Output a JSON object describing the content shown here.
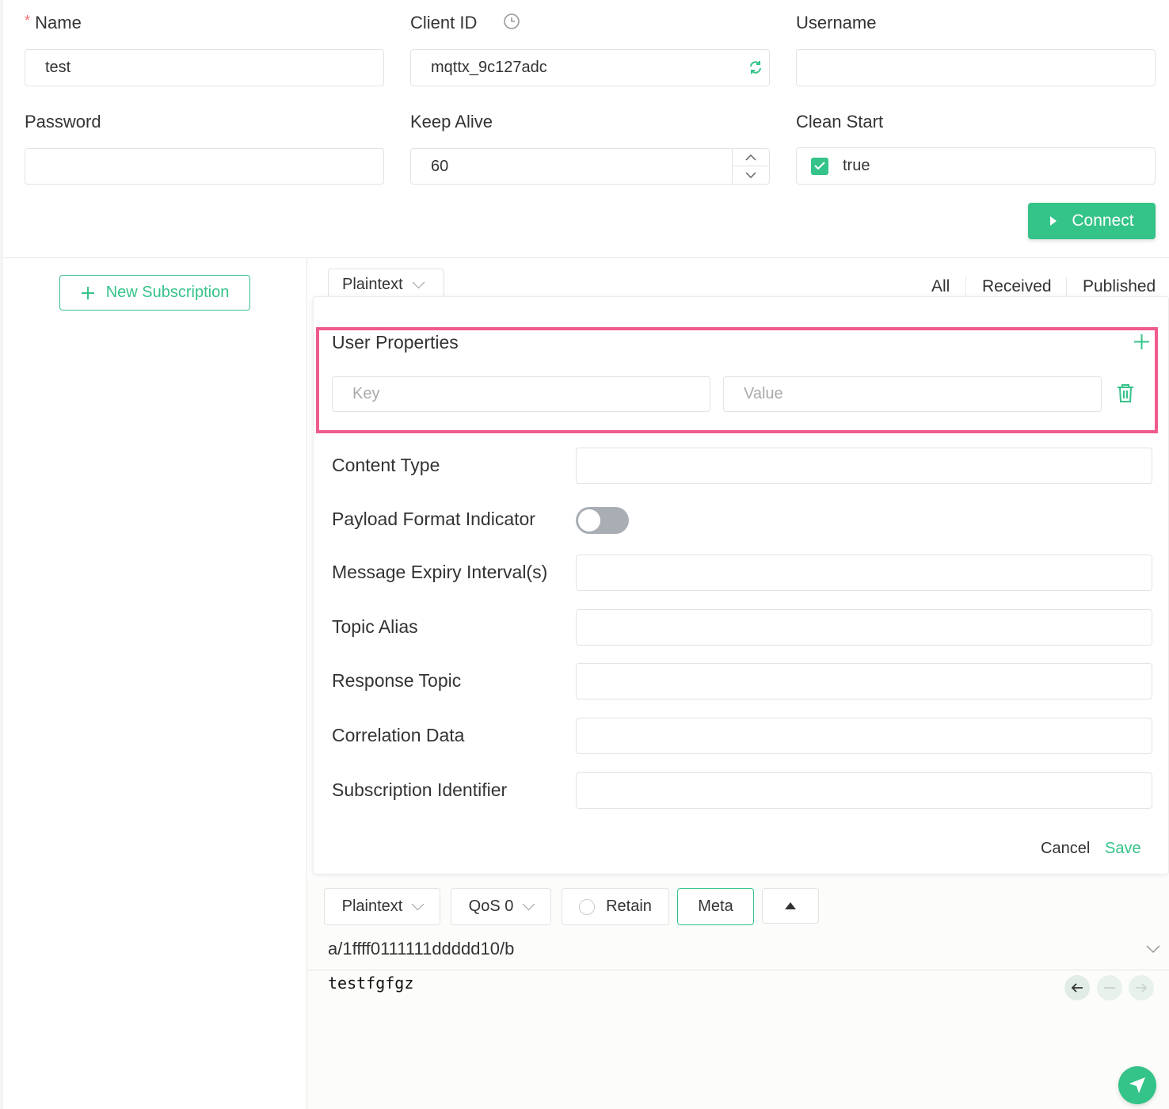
{
  "connection": {
    "name_label": "Name",
    "name_required_mark": "*",
    "name_value": "test",
    "client_id_label": "Client ID",
    "client_id_value": "mqttx_9c127adc",
    "username_label": "Username",
    "username_value": "",
    "password_label": "Password",
    "password_value": "",
    "keep_alive_label": "Keep Alive",
    "keep_alive_value": "60",
    "clean_start_label": "Clean Start",
    "clean_start_value": "true",
    "clean_start_checked": true,
    "connect_label": "Connect"
  },
  "subscriptions": {
    "new_subscription_label": "New Subscription"
  },
  "messages": {
    "format_select": "Plaintext",
    "tabs": [
      "All",
      "Received",
      "Published"
    ],
    "active_tab": "All"
  },
  "meta_panel": {
    "user_properties_label": "User Properties",
    "key_placeholder": "Key",
    "value_placeholder": "Value",
    "fields": [
      {
        "label": "Content Type",
        "type": "text",
        "value": ""
      },
      {
        "label": "Payload Format Indicator",
        "type": "switch",
        "value": false
      },
      {
        "label": "Message Expiry Interval(s)",
        "type": "text",
        "value": ""
      },
      {
        "label": "Topic Alias",
        "type": "text",
        "value": ""
      },
      {
        "label": "Response Topic",
        "type": "text",
        "value": ""
      },
      {
        "label": "Correlation Data",
        "type": "text",
        "value": ""
      },
      {
        "label": "Subscription Identifier",
        "type": "text",
        "value": ""
      }
    ],
    "cancel_label": "Cancel",
    "save_label": "Save"
  },
  "publish": {
    "format": "Plaintext",
    "qos": "QoS 0",
    "retain_label": "Retain",
    "retain_checked": false,
    "meta_label": "Meta",
    "topic": "a/1ffff0111111ddddd10/b",
    "payload": "testfgfgz"
  },
  "icons": {
    "clock": "clock-icon",
    "refresh": "refresh-icon",
    "plus": "plus-icon",
    "trash": "trash-icon",
    "send": "send-icon"
  },
  "colors": {
    "accent": "#34c388",
    "highlight_border": "#ef5b8f",
    "required": "#f56c6c"
  }
}
